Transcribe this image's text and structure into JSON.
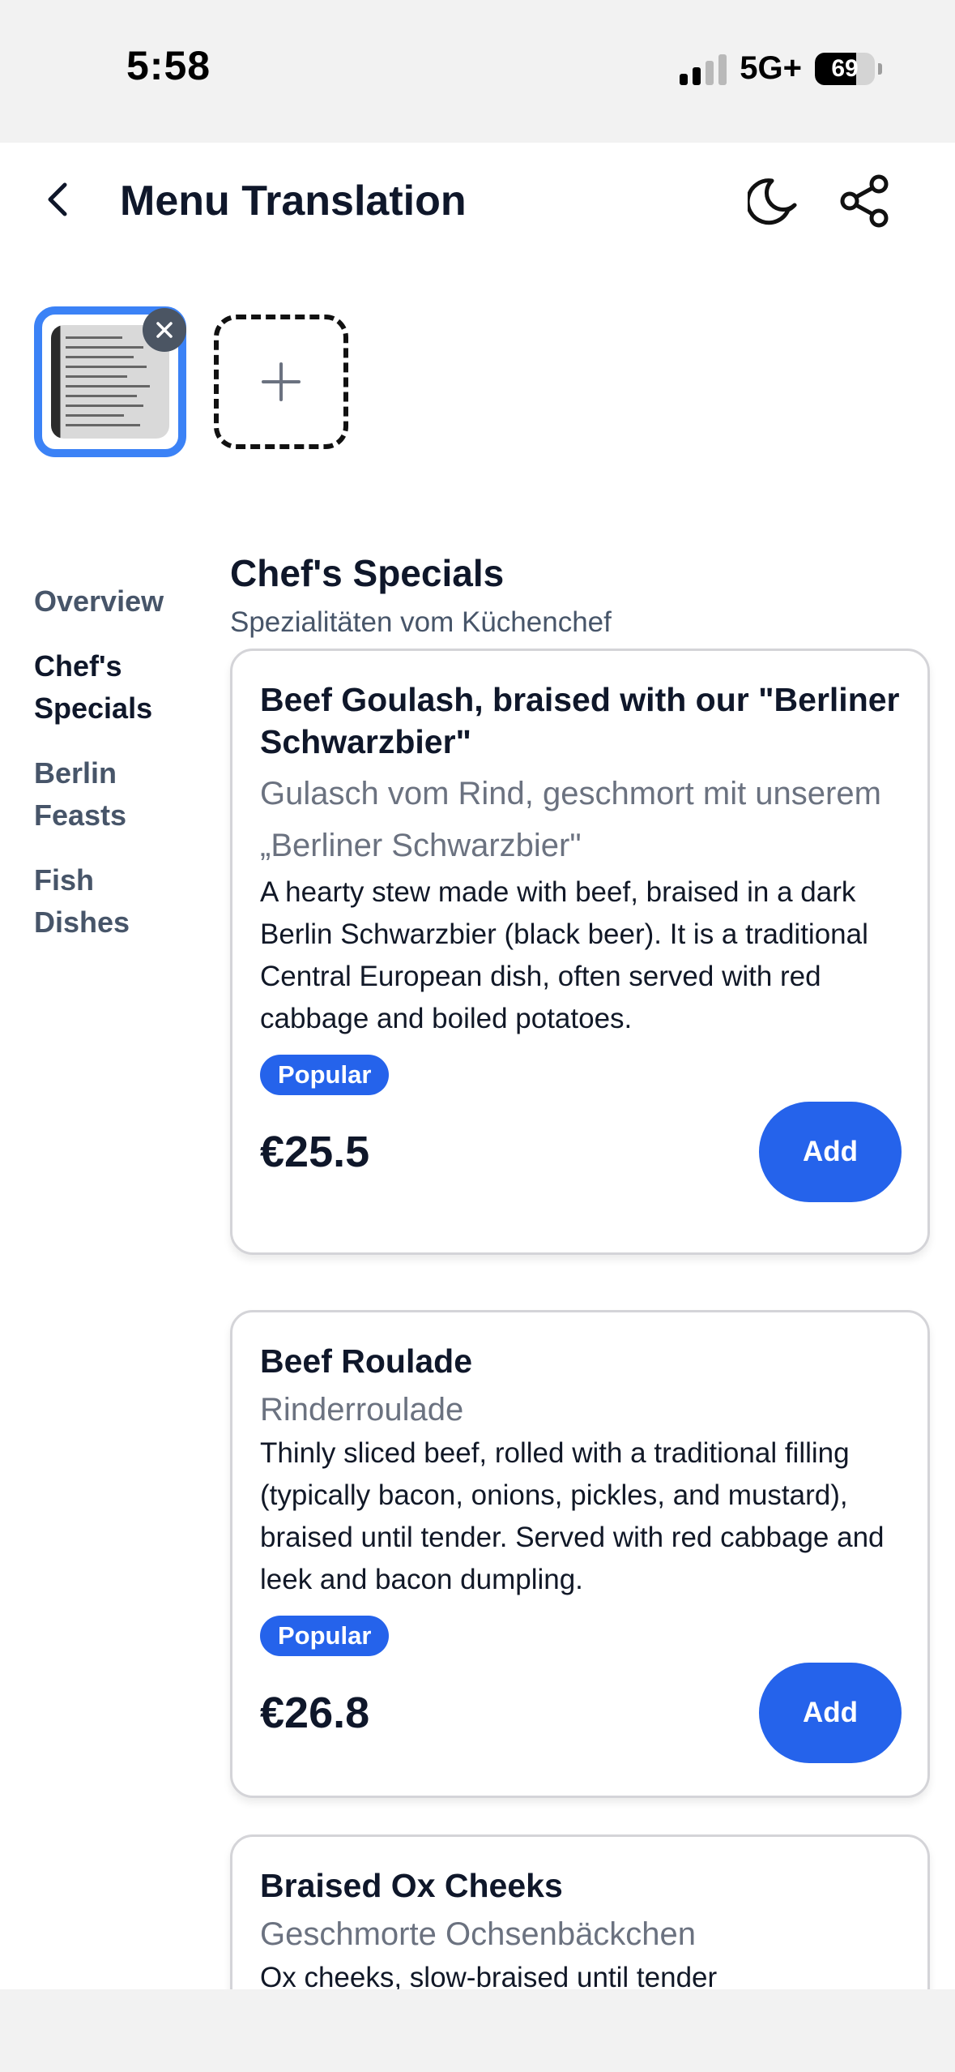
{
  "status_bar": {
    "time": "5:58",
    "network": "5G+",
    "battery_percent": "69",
    "battery_level": 0.69,
    "signal_bars_active": 2
  },
  "header": {
    "title": "Menu Translation",
    "back_icon": "chevron-left-icon",
    "theme_icon": "moon-icon",
    "share_icon": "share-icon"
  },
  "photos": {
    "thumbnail_icon": "menu-photo",
    "remove_icon": "close-icon",
    "add_icon": "plus-icon"
  },
  "sidebar": {
    "items": [
      {
        "label": "Overview",
        "active": false
      },
      {
        "label": "Chef's Specials",
        "active": true
      },
      {
        "label": "Berlin Feasts",
        "active": false
      },
      {
        "label": "Fish Dishes",
        "active": false
      }
    ]
  },
  "section": {
    "title": "Chef's Specials",
    "subtitle": "Spezialitäten vom Küchenchef"
  },
  "dishes": [
    {
      "name": "Beef Goulash, braised with our \"Berliner Schwarzbier\"",
      "original": "Gulasch vom Rind, geschmort mit unserem „Berliner Schwarzbier\"",
      "description": "A hearty stew made with beef, braised in a dark Berlin Schwarzbier (black beer). It is a traditional Central European dish, often served with red cabbage and boiled potatoes.",
      "badge": "Popular",
      "price": "€25.5",
      "add_label": "Add"
    },
    {
      "name": "Beef Roulade",
      "original": "Rinderroulade",
      "description": "Thinly sliced beef, rolled with a traditional filling (typically bacon, onions, pickles, and mustard), braised until tender. Served with red cabbage and leek and bacon dumpling.",
      "badge": "Popular",
      "price": "€26.8",
      "add_label": "Add"
    },
    {
      "name": "Braised Ox Cheeks",
      "original": "Geschmorte Ochsenbäckchen",
      "description": "Ox cheeks, slow-braised until tender"
    }
  ],
  "colors": {
    "accent": "#2563eb",
    "thumb_border": "#3b82f6",
    "text_primary": "#0f172a",
    "text_secondary": "#6b7280"
  }
}
